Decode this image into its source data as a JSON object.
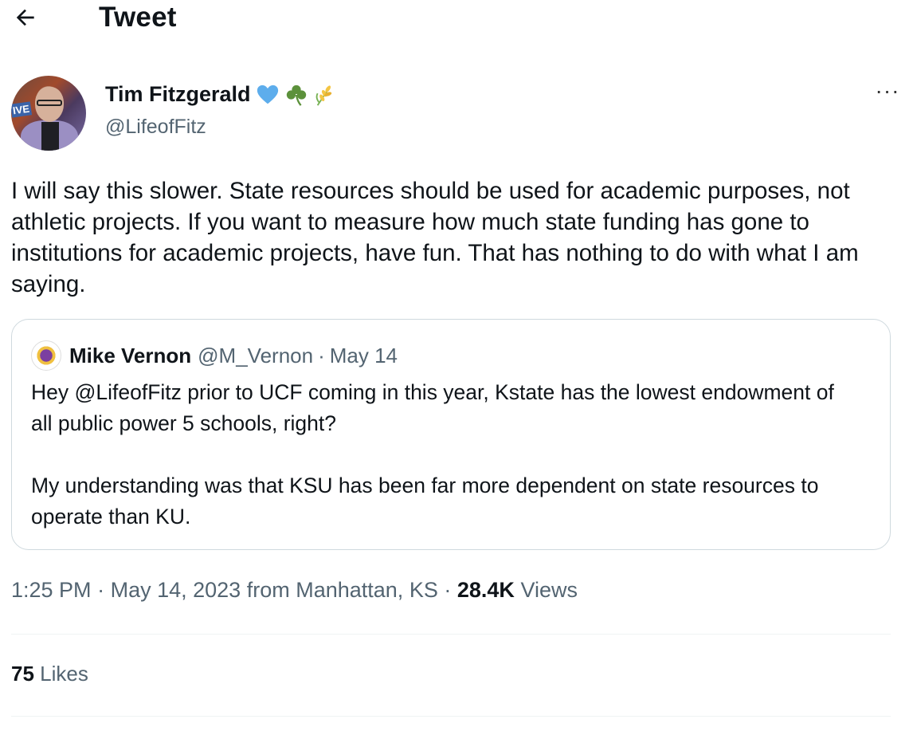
{
  "header": {
    "title": "Tweet",
    "back_icon": "arrow-left-icon"
  },
  "author": {
    "display_name": "Tim Fitzgerald",
    "emojis": [
      "blue-heart-icon",
      "shamrock-icon",
      "wheat-icon"
    ],
    "handle": "@LifeofFitz",
    "more_icon": "more-dots-icon"
  },
  "tweet": {
    "text": "I will say this slower. State resources should be used for academic purposes, not athletic projects. If you want to measure how much state funding has gone to institutions for academic projects, have fun. That has nothing to do with what I am saying."
  },
  "quote": {
    "name": "Mike Vernon",
    "handle": "@M_Vernon",
    "separator": "·",
    "date": "May 14",
    "paragraphs": [
      "Hey @LifeofFitz prior to UCF coming in this year, Kstate has the lowest endowment of all public power 5 schools, right?",
      "My understanding was that KSU has been far more dependent on state resources to operate than KU."
    ]
  },
  "meta": {
    "time": "1:25 PM",
    "sep1": "·",
    "date": "May 14, 2023",
    "location": "from Manhattan, KS",
    "sep2": "·",
    "views_count": "28.4K",
    "views_label": "Views"
  },
  "stats": {
    "likes_count": "75",
    "likes_label": "Likes"
  },
  "colors": {
    "text": "#0f1419",
    "secondary": "#536471",
    "border": "#cfd9de",
    "divider": "#eff3f4"
  }
}
